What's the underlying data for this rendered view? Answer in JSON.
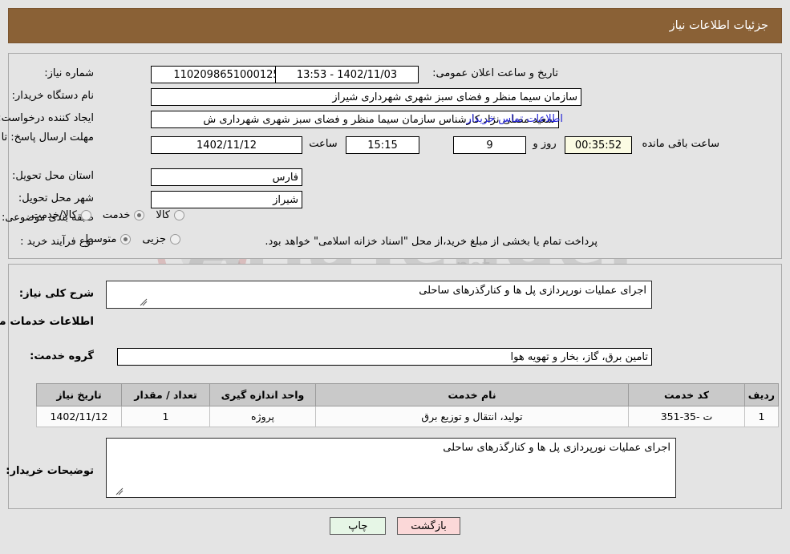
{
  "header": {
    "title": "جزئیات اطلاعات نیاز"
  },
  "form": {
    "need_number_label": "شماره نیاز:",
    "need_number_value": "1102098651000125",
    "announce_datetime_label": "تاریخ و ساعت اعلان عمومی:",
    "announce_datetime_value": "1402/11/03 - 13:53",
    "buyer_org_label": "نام دستگاه خریدار:",
    "buyer_org_value": "سازمان سیما منظر و فضای سبز شهری شهرداری شیراز",
    "requester_label": "ایجاد کننده درخواست:",
    "requester_value": "سعید مصلی نژاد کارشناس سازمان سیما منظر و فضای سبز شهری شهرداری ش",
    "buyer_contact_link": "اطلاعات تماس خریدار",
    "deadline_label": "مهلت ارسال پاسخ: تا تاریخ:",
    "deadline_date": "1402/11/12",
    "deadline_hour_label": "ساعت",
    "deadline_time": "15:15",
    "remaining_days": "9",
    "remaining_days_label": "روز و",
    "remaining_time": "00:35:52",
    "remaining_time_label": "ساعت باقی مانده",
    "province_label": "استان محل تحویل:",
    "province_value": "فارس",
    "city_label": "شهر محل تحویل:",
    "city_value": "شیراز",
    "category_label": "طبقه بندی موضوعی:",
    "category_options": [
      {
        "label": "کالا",
        "selected": false
      },
      {
        "label": "خدمت",
        "selected": true
      },
      {
        "label": "کالا/خدمت",
        "selected": false
      }
    ],
    "process_label": "نوع فرآیند خرید :",
    "process_options": [
      {
        "label": "جزیی",
        "selected": false
      },
      {
        "label": "متوسط",
        "selected": true
      }
    ],
    "process_note": "پرداخت تمام یا بخشی از مبلغ خرید،از محل \"اسناد خزانه اسلامی\" خواهد بود."
  },
  "detail": {
    "general_desc_label": "شرح کلی نیاز:",
    "general_desc_value": "اجرای عملیات نورپردازی پل ها و کنارگذرهای ساحلی",
    "services_section_title": "اطلاعات خدمات مورد نیاز",
    "service_group_label": "گروه خدمت:",
    "service_group_value": "تامین برق، گاز، بخار و تهویه هوا",
    "buyer_notes_label": "توضیحات خریدار:",
    "buyer_notes_value": "اجرای عملیات نورپردازی پل ها و کنارگذرهای ساحلی"
  },
  "table": {
    "columns": [
      "ردیف",
      "کد خدمت",
      "نام خدمت",
      "واحد اندازه گیری",
      "تعداد / مقدار",
      "تاریخ نیاز"
    ],
    "rows": [
      {
        "index": "1",
        "code": "ت -35-351",
        "name": "تولید، انتقال و توزیع برق",
        "unit": "پروژه",
        "quantity": "1",
        "date": "1402/11/12"
      }
    ]
  },
  "footer": {
    "print_label": "چاپ",
    "back_label": "بازگشت"
  },
  "watermark": {
    "brand": "AriaTender",
    "suffix": ".net"
  },
  "colors": {
    "header_bar": "#8a6136",
    "link": "#2424d8",
    "back_button": "#fbd8d8",
    "print_button": "#e6f6e6",
    "highlight_field": "#fbfbe3",
    "table_header": "#c9c9c9"
  }
}
